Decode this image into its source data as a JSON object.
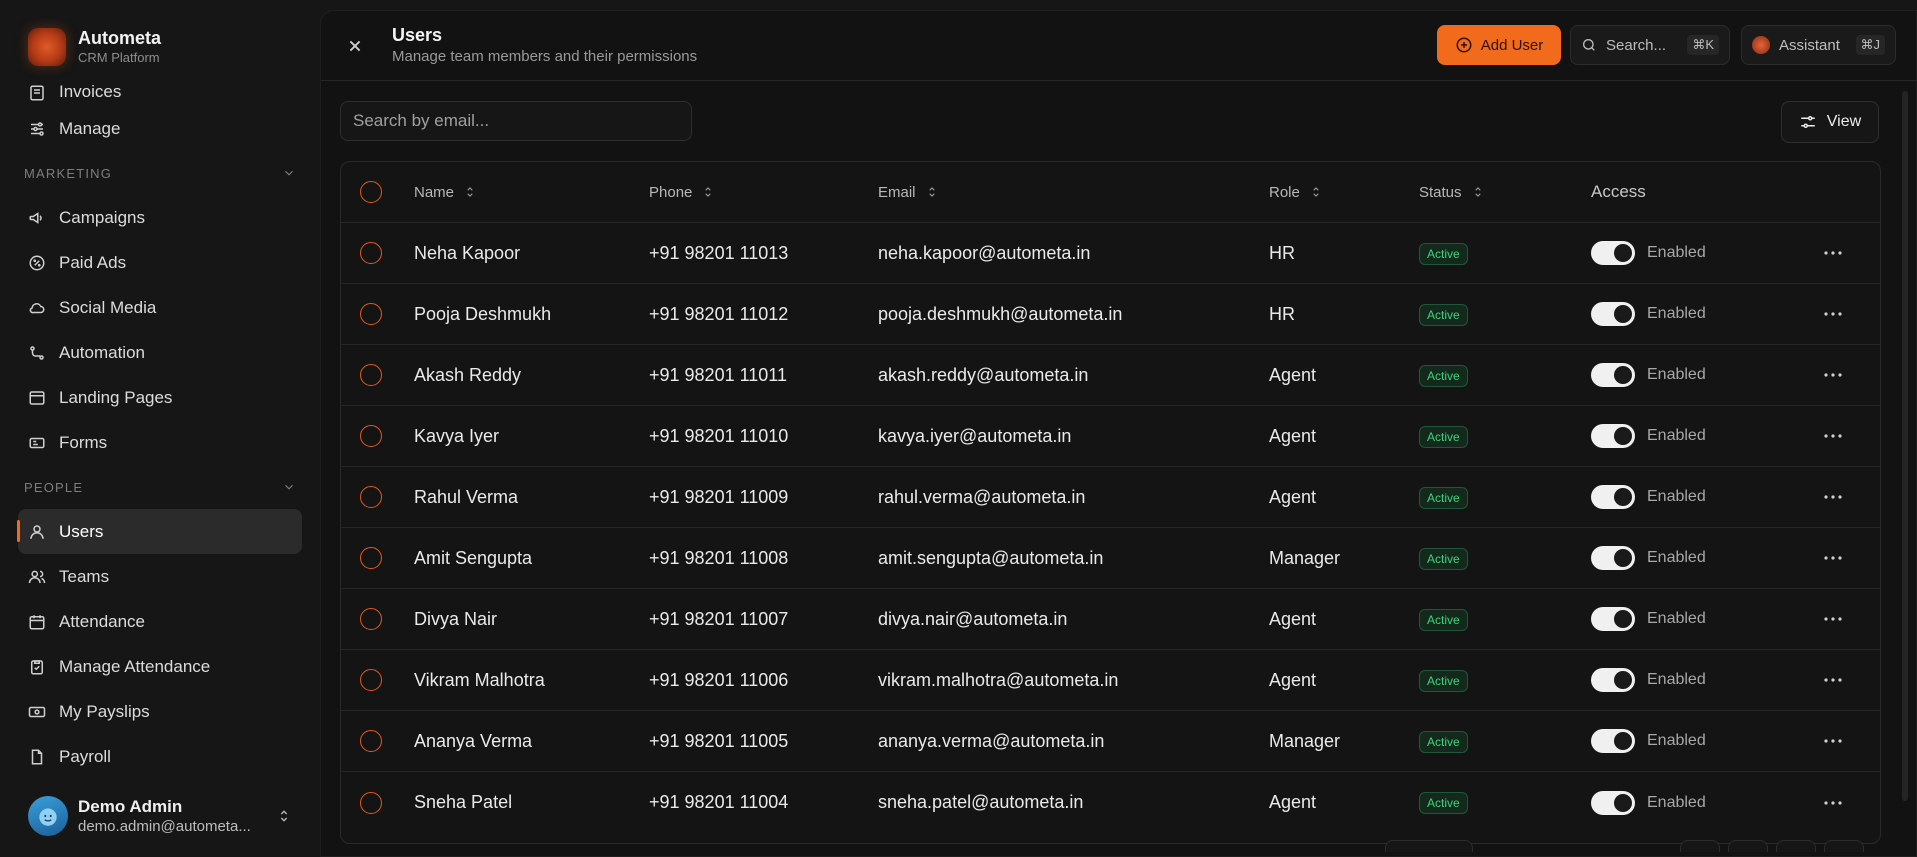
{
  "brand": {
    "name": "Autometa",
    "subtitle": "CRM Platform"
  },
  "sidebar": {
    "items_top": [
      {
        "label": "Invoices",
        "icon": "invoice-icon"
      },
      {
        "label": "Manage",
        "icon": "sliders-icon"
      }
    ],
    "marketing_section": "MARKETING",
    "marketing_items": [
      {
        "label": "Campaigns",
        "icon": "megaphone-icon"
      },
      {
        "label": "Paid Ads",
        "icon": "badge-percent-icon"
      },
      {
        "label": "Social Media",
        "icon": "cloud-icon"
      },
      {
        "label": "Automation",
        "icon": "workflow-icon"
      },
      {
        "label": "Landing Pages",
        "icon": "layout-icon"
      },
      {
        "label": "Forms",
        "icon": "form-icon"
      }
    ],
    "people_section": "PEOPLE",
    "people_items": [
      {
        "label": "Users",
        "icon": "user-icon",
        "active": true
      },
      {
        "label": "Teams",
        "icon": "users-icon"
      },
      {
        "label": "Attendance",
        "icon": "calendar-icon"
      },
      {
        "label": "Manage Attendance",
        "icon": "clipboard-check-icon"
      },
      {
        "label": "My Payslips",
        "icon": "banknote-icon"
      },
      {
        "label": "Payroll",
        "icon": "file-icon"
      }
    ]
  },
  "current_user": {
    "name": "Demo Admin",
    "email": "demo.admin@autometa..."
  },
  "header": {
    "title": "Users",
    "subtitle": "Manage team members and their permissions",
    "add_user_label": "Add User",
    "search_label": "Search...",
    "search_shortcut": "⌘K",
    "assistant_label": "Assistant",
    "assistant_shortcut": "⌘J"
  },
  "toolbar": {
    "filter_placeholder": "Search by email...",
    "view_label": "View"
  },
  "table": {
    "columns": {
      "name": "Name",
      "phone": "Phone",
      "email": "Email",
      "role": "Role",
      "status": "Status",
      "access": "Access"
    },
    "rows": [
      {
        "name": "Neha Kapoor",
        "phone": "+91 98201 11013",
        "email": "neha.kapoor@autometa.in",
        "role": "HR",
        "status": "Active",
        "access": "Enabled"
      },
      {
        "name": "Pooja Deshmukh",
        "phone": "+91 98201 11012",
        "email": "pooja.deshmukh@autometa.in",
        "role": "HR",
        "status": "Active",
        "access": "Enabled"
      },
      {
        "name": "Akash Reddy",
        "phone": "+91 98201 11011",
        "email": "akash.reddy@autometa.in",
        "role": "Agent",
        "status": "Active",
        "access": "Enabled"
      },
      {
        "name": "Kavya Iyer",
        "phone": "+91 98201 11010",
        "email": "kavya.iyer@autometa.in",
        "role": "Agent",
        "status": "Active",
        "access": "Enabled"
      },
      {
        "name": "Rahul Verma",
        "phone": "+91 98201 11009",
        "email": "rahul.verma@autometa.in",
        "role": "Agent",
        "status": "Active",
        "access": "Enabled"
      },
      {
        "name": "Amit Sengupta",
        "phone": "+91 98201 11008",
        "email": "amit.sengupta@autometa.in",
        "role": "Manager",
        "status": "Active",
        "access": "Enabled"
      },
      {
        "name": "Divya Nair",
        "phone": "+91 98201 11007",
        "email": "divya.nair@autometa.in",
        "role": "Agent",
        "status": "Active",
        "access": "Enabled"
      },
      {
        "name": "Vikram Malhotra",
        "phone": "+91 98201 11006",
        "email": "vikram.malhotra@autometa.in",
        "role": "Agent",
        "status": "Active",
        "access": "Enabled"
      },
      {
        "name": "Ananya Verma",
        "phone": "+91 98201 11005",
        "email": "ananya.verma@autometa.in",
        "role": "Manager",
        "status": "Active",
        "access": "Enabled"
      },
      {
        "name": "Sneha Patel",
        "phone": "+91 98201 11004",
        "email": "sneha.patel@autometa.in",
        "role": "Agent",
        "status": "Active",
        "access": "Enabled"
      }
    ]
  },
  "colors": {
    "accent": "#f26a1b",
    "status_active": "#3fd37c",
    "background": "#161616",
    "panel": "#121212"
  }
}
